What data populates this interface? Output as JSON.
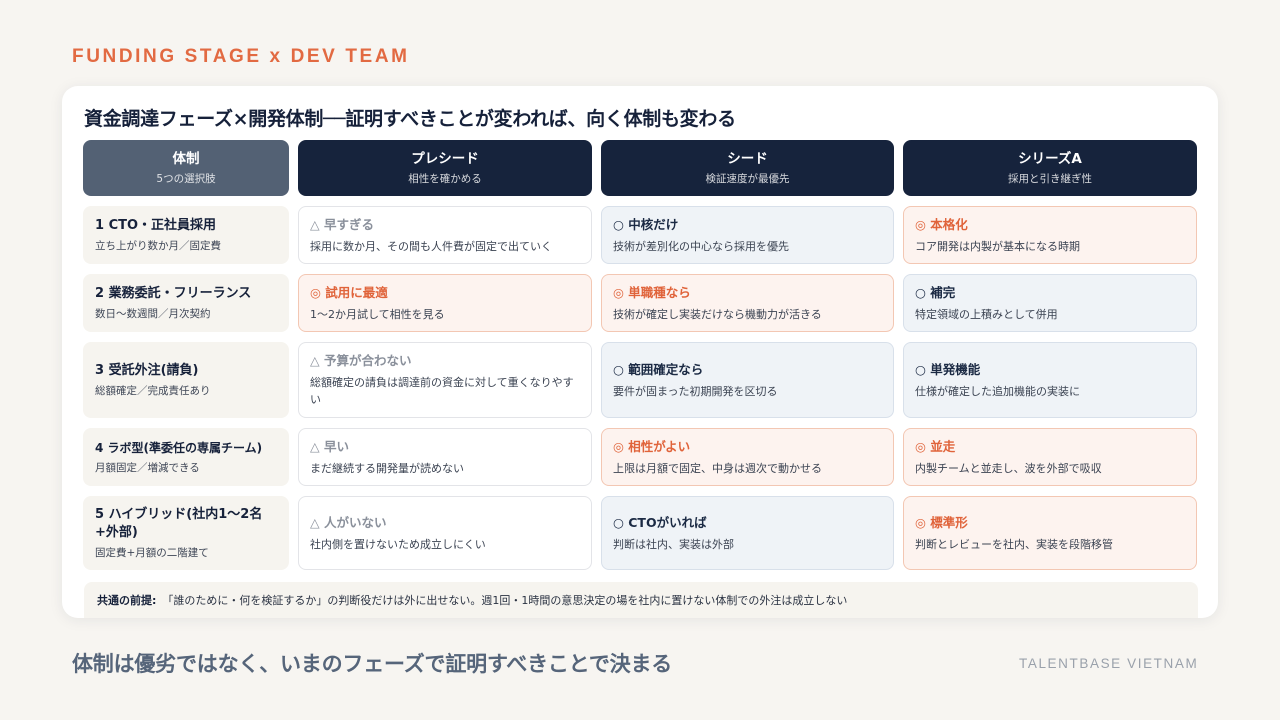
{
  "eyebrow": "FUNDING STAGE x DEV TEAM",
  "card_title": "資金調達フェーズ×開発体制──証明すべきことが変われば、向く体制も変わる",
  "headers": [
    {
      "title": "体制",
      "sub": "5つの選択肢"
    },
    {
      "title": "プレシード",
      "sub": "相性を確かめる"
    },
    {
      "title": "シード",
      "sub": "検証速度が最優先"
    },
    {
      "title": "シリーズA",
      "sub": "採用と引き継ぎ性"
    }
  ],
  "rows": [
    {
      "title": "1 CTO・正社員採用",
      "sub": "立ち上がり数か月／固定費",
      "cells": [
        {
          "style": "plain",
          "title": "△ 早すぎる",
          "desc": "採用に数か月、その間も人件費が固定で出ていく"
        },
        {
          "style": "blue",
          "title": "○ 中核だけ",
          "desc": "技術が差別化の中心なら採用を優先"
        },
        {
          "style": "orange",
          "title": "◎ 本格化",
          "desc": "コア開発は内製が基本になる時期"
        }
      ]
    },
    {
      "title": "2 業務委託・フリーランス",
      "sub": "数日〜数週間／月次契約",
      "cells": [
        {
          "style": "orange",
          "title": "◎ 試用に最適",
          "desc": "1〜2か月試して相性を見る"
        },
        {
          "style": "orange",
          "title": "◎ 単職種なら",
          "desc": "技術が確定し実装だけなら機動力が活きる"
        },
        {
          "style": "blue",
          "title": "○ 補完",
          "desc": "特定領域の上積みとして併用"
        }
      ]
    },
    {
      "title": "3 受託外注(請負)",
      "sub": "総額確定／完成責任あり",
      "cells": [
        {
          "style": "plain",
          "title": "△ 予算が合わない",
          "desc": "総額確定の請負は調達前の資金に対して重くなりやすい"
        },
        {
          "style": "blue",
          "title": "○ 範囲確定なら",
          "desc": "要件が固まった初期開発を区切る"
        },
        {
          "style": "blue",
          "title": "○ 単発機能",
          "desc": "仕様が確定した追加機能の実装に"
        }
      ]
    },
    {
      "title": "4 ラボ型(準委任の専属チーム)",
      "sub": "月額固定／増減できる",
      "cells": [
        {
          "style": "plain",
          "title": "△ 早い",
          "desc": "まだ継続する開発量が読めない"
        },
        {
          "style": "orange",
          "title": "◎ 相性がよい",
          "desc": "上限は月額で固定、中身は週次で動かせる"
        },
        {
          "style": "orange",
          "title": "◎ 並走",
          "desc": "内製チームと並走し、波を外部で吸収"
        }
      ]
    },
    {
      "title": "5 ハイブリッド(社内1〜2名+外部)",
      "sub": "固定費+月額の二階建て",
      "cells": [
        {
          "style": "plain",
          "title": "△ 人がいない",
          "desc": "社内側を置けないため成立しにくい"
        },
        {
          "style": "blue",
          "title": "○ CTOがいれば",
          "desc": "判断は社内、実装は外部"
        },
        {
          "style": "orange",
          "title": "◎ 標準形",
          "desc": "判断とレビューを社内、実装を段階移管"
        }
      ]
    }
  ],
  "premise": {
    "label": "共通の前提:",
    "text": "「誰のために・何を検証するか」の判断役だけは外に出せない。週1回・1時間の意思決定の場を社内に置けない体制での外注は成立しない"
  },
  "footer_message": "体制は優劣ではなく、いまのフェーズで証明すべきことで決まる",
  "brand": "TALENTBASE VIETNAM"
}
